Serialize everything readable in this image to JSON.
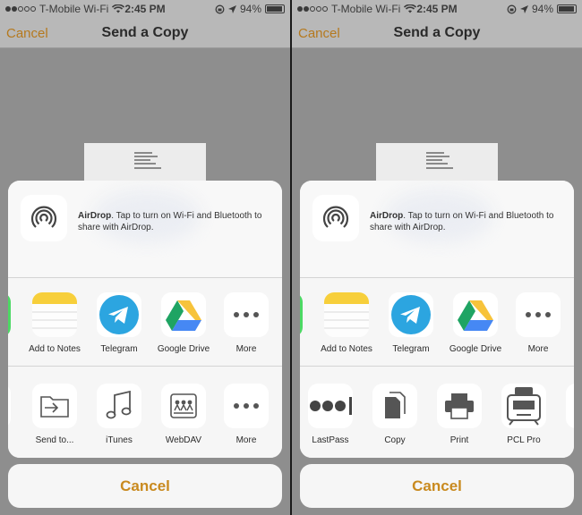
{
  "screens": [
    {
      "status": {
        "carrier": "T-Mobile Wi-Fi",
        "time": "2:45 PM",
        "battery": "94%"
      },
      "nav": {
        "cancel_label": "Cancel",
        "title": "Send a Copy"
      },
      "airdrop": {
        "title": "AirDrop",
        "text": ". Tap to turn on Wi-Fi and Bluetooth to share with AirDrop."
      },
      "apps": [
        {
          "label": "",
          "icon": "messages-icon"
        },
        {
          "label": "Add to Notes",
          "icon": "notes-icon"
        },
        {
          "label": "Telegram",
          "icon": "telegram-icon"
        },
        {
          "label": "Google Drive",
          "icon": "google-drive-icon"
        },
        {
          "label": "More",
          "icon": "more-icon"
        }
      ],
      "actions": [
        {
          "label": "",
          "icon": "partial-icon"
        },
        {
          "label": "Send to...",
          "icon": "send-to-icon"
        },
        {
          "label": "iTunes",
          "icon": "itunes-icon"
        },
        {
          "label": "WebDAV",
          "icon": "webdav-icon"
        },
        {
          "label": "More",
          "icon": "more-icon"
        }
      ],
      "cancel_label": "Cancel"
    },
    {
      "status": {
        "carrier": "T-Mobile Wi-Fi",
        "time": "2:45 PM",
        "battery": "94%"
      },
      "nav": {
        "cancel_label": "Cancel",
        "title": "Send a Copy"
      },
      "airdrop": {
        "title": "AirDrop",
        "text": ". Tap to turn on Wi-Fi and Bluetooth to share with AirDrop."
      },
      "apps": [
        {
          "label": "",
          "icon": "messages-icon"
        },
        {
          "label": "Add to Notes",
          "icon": "notes-icon"
        },
        {
          "label": "Telegram",
          "icon": "telegram-icon"
        },
        {
          "label": "Google Drive",
          "icon": "google-drive-icon"
        },
        {
          "label": "More",
          "icon": "more-icon"
        }
      ],
      "actions": [
        {
          "label": "LastPass",
          "icon": "lastpass-icon"
        },
        {
          "label": "Copy",
          "icon": "copy-icon"
        },
        {
          "label": "Print",
          "icon": "print-icon"
        },
        {
          "label": "PCL Pro",
          "icon": "pcl-pro-icon"
        },
        {
          "label": "",
          "icon": "partial-icon"
        }
      ],
      "cancel_label": "Cancel"
    }
  ],
  "colors": {
    "accent": "#c98a1f",
    "telegram": "#2ca5e0",
    "notes": "#f7cf3b",
    "messages": "#4cd964"
  }
}
